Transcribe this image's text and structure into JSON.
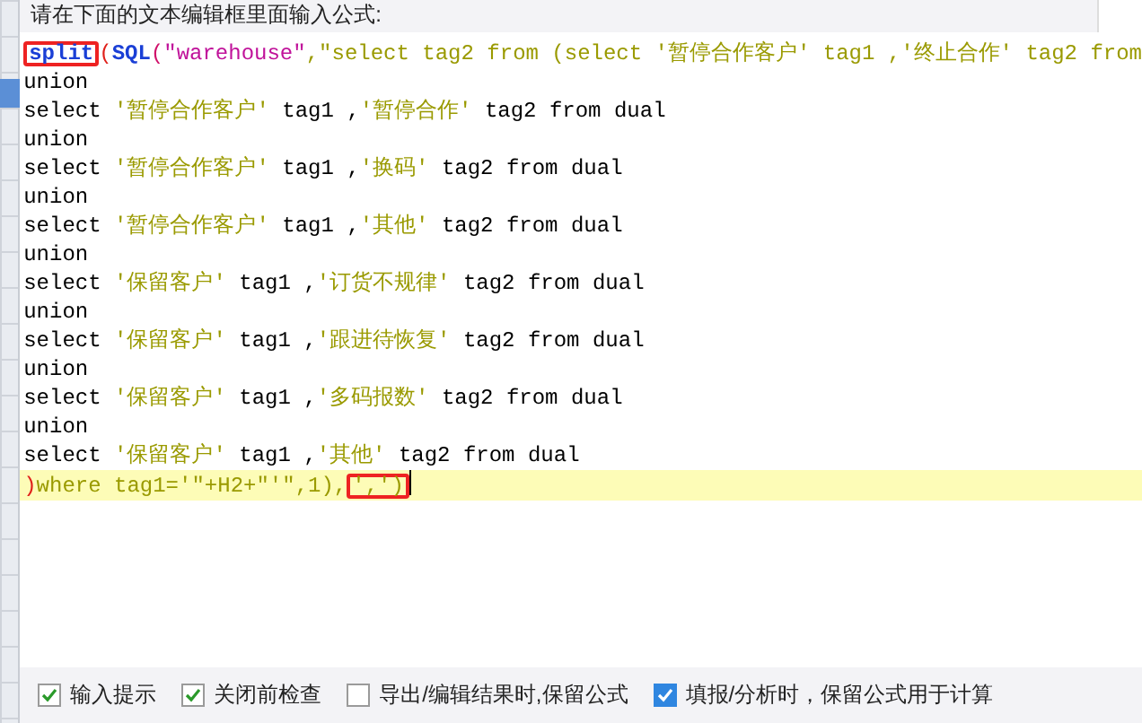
{
  "prompt": "请在下面的文本编辑框里面输入公式:",
  "editor": {
    "lines": [
      {
        "current": false,
        "segments": [
          {
            "kind": "func",
            "text": "split",
            "marked": true
          },
          {
            "kind": "paren",
            "text": "("
          },
          {
            "kind": "func",
            "text": "SQL"
          },
          {
            "kind": "paren2",
            "text": "("
          },
          {
            "kind": "string2",
            "text": "\"warehouse\""
          },
          {
            "kind": "string",
            "text": ",\"select tag2 from (select '暂停合作客户' tag1 ,'终止合作' tag2 from"
          }
        ]
      },
      {
        "current": false,
        "segments": [
          {
            "kind": "plain",
            "text": "union"
          }
        ]
      },
      {
        "current": false,
        "segments": [
          {
            "kind": "plain",
            "text": "select "
          },
          {
            "kind": "string",
            "text": "'暂停合作客户'"
          },
          {
            "kind": "plain",
            "text": " tag1 ,"
          },
          {
            "kind": "string",
            "text": "'暂停合作'"
          },
          {
            "kind": "plain",
            "text": " tag2 from dual"
          }
        ]
      },
      {
        "current": false,
        "segments": [
          {
            "kind": "plain",
            "text": "union"
          }
        ]
      },
      {
        "current": false,
        "segments": [
          {
            "kind": "plain",
            "text": "select "
          },
          {
            "kind": "string",
            "text": "'暂停合作客户'"
          },
          {
            "kind": "plain",
            "text": " tag1 ,"
          },
          {
            "kind": "string",
            "text": "'换码'"
          },
          {
            "kind": "plain",
            "text": " tag2 from dual"
          }
        ]
      },
      {
        "current": false,
        "segments": [
          {
            "kind": "plain",
            "text": "union"
          }
        ]
      },
      {
        "current": false,
        "segments": [
          {
            "kind": "plain",
            "text": "select "
          },
          {
            "kind": "string",
            "text": "'暂停合作客户'"
          },
          {
            "kind": "plain",
            "text": " tag1 ,"
          },
          {
            "kind": "string",
            "text": "'其他'"
          },
          {
            "kind": "plain",
            "text": " tag2 from dual"
          }
        ]
      },
      {
        "current": false,
        "segments": [
          {
            "kind": "plain",
            "text": "union"
          }
        ]
      },
      {
        "current": false,
        "segments": [
          {
            "kind": "plain",
            "text": "select "
          },
          {
            "kind": "string",
            "text": "'保留客户'"
          },
          {
            "kind": "plain",
            "text": " tag1 ,"
          },
          {
            "kind": "string",
            "text": "'订货不规律'"
          },
          {
            "kind": "plain",
            "text": " tag2 from dual"
          }
        ]
      },
      {
        "current": false,
        "segments": [
          {
            "kind": "plain",
            "text": "union"
          }
        ]
      },
      {
        "current": false,
        "segments": [
          {
            "kind": "plain",
            "text": "select "
          },
          {
            "kind": "string",
            "text": "'保留客户'"
          },
          {
            "kind": "plain",
            "text": " tag1 ,"
          },
          {
            "kind": "string",
            "text": "'跟进待恢复'"
          },
          {
            "kind": "plain",
            "text": " tag2 from dual"
          }
        ]
      },
      {
        "current": false,
        "segments": [
          {
            "kind": "plain",
            "text": "union"
          }
        ]
      },
      {
        "current": false,
        "segments": [
          {
            "kind": "plain",
            "text": "select "
          },
          {
            "kind": "string",
            "text": "'保留客户'"
          },
          {
            "kind": "plain",
            "text": " tag1 ,"
          },
          {
            "kind": "string",
            "text": "'多码报数'"
          },
          {
            "kind": "plain",
            "text": " tag2 from dual"
          }
        ]
      },
      {
        "current": false,
        "segments": [
          {
            "kind": "plain",
            "text": "union"
          }
        ]
      },
      {
        "current": false,
        "segments": [
          {
            "kind": "plain",
            "text": "select "
          },
          {
            "kind": "string",
            "text": "'保留客户'"
          },
          {
            "kind": "plain",
            "text": " tag1 ,"
          },
          {
            "kind": "string",
            "text": "'其他'"
          },
          {
            "kind": "plain",
            "text": " tag2 from dual"
          }
        ]
      },
      {
        "current": true,
        "segments": [
          {
            "kind": "paren",
            "text": ")"
          },
          {
            "kind": "string",
            "text": "where tag1='\"+H2+\"'\",1),"
          },
          {
            "kind": "string",
            "text": "',')",
            "marked": true
          }
        ]
      }
    ]
  },
  "options": [
    {
      "kind": "tick",
      "label": "输入提示",
      "checked": true
    },
    {
      "kind": "tick",
      "label": "关闭前检查",
      "checked": true
    },
    {
      "kind": "tick",
      "label": "导出/编辑结果时,保留公式",
      "checked": false
    },
    {
      "kind": "filled",
      "label": "填报/分析时，保留公式用于计算",
      "checked": true
    }
  ]
}
